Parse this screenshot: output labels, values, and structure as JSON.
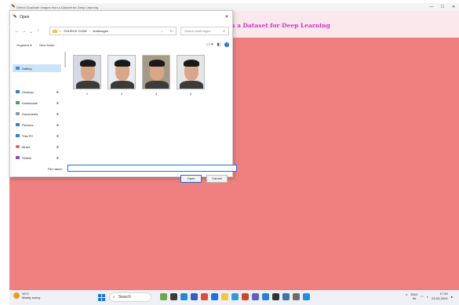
{
  "app": {
    "window_title": "Detect Duplicate Images from a Dataset for Deep Learning",
    "heading": "n a Dataset for Deep Learning",
    "controls": [
      "—",
      "☐",
      "✕"
    ],
    "colors": {
      "body": "#f08080",
      "header": "#fbe8ec",
      "heading": "#cc33cc"
    }
  },
  "dialog": {
    "title": "Open",
    "close": "✕",
    "breadcrumb": [
      "SOURCE CODE",
      "testImages"
    ],
    "breadcrumb_prefix": "«",
    "search_placeholder": "Search testImages",
    "organize_label": "Organize ▾",
    "new_folder_label": "New folder",
    "sidebar": {
      "items": [
        {
          "label": "Gallery",
          "icon": "gallery-icon",
          "color": "#3c8ee6"
        },
        {
          "label": "Desktop",
          "icon": "desktop-icon",
          "color": "#2f7fd6"
        },
        {
          "label": "Downloads",
          "icon": "download-icon",
          "color": "#2fae5a"
        },
        {
          "label": "Documents",
          "icon": "document-icon",
          "color": "#8a9bb0"
        },
        {
          "label": "Pictures",
          "icon": "pictures-icon",
          "color": "#2d88d8"
        },
        {
          "label": "This PC",
          "icon": "pc-icon",
          "color": "#2f7fd6"
        },
        {
          "label": "Music",
          "icon": "music-icon",
          "color": "#e8563a"
        },
        {
          "label": "Videos",
          "icon": "video-icon",
          "color": "#8b4cc9"
        }
      ]
    },
    "files": [
      {
        "name": "1",
        "bg": "#d6d9df"
      },
      {
        "name": "2",
        "bg": "#e9ecf0"
      },
      {
        "name": "3",
        "bg": "#a69a86"
      },
      {
        "name": "4",
        "bg": "#e6e6e6"
      }
    ],
    "filename_label": "File name:",
    "filename_value": "",
    "open_label": "Open",
    "cancel_label": "Cancel"
  },
  "taskbar": {
    "weather_temp": "19°C",
    "weather_desc": "Mostly sunny",
    "search_label": "Search",
    "lang_top": "ENG",
    "lang_bottom": "IN",
    "time": "17:29",
    "date": "23-03-2024",
    "apps": [
      {
        "icon": "widgets-icon",
        "color": "#6aa84f"
      },
      {
        "icon": "taskview-icon",
        "color": "#3c3c3c"
      },
      {
        "icon": "edge-icon",
        "color": "#1d8ad6"
      },
      {
        "icon": "store-icon",
        "color": "#2b62c4"
      },
      {
        "icon": "chrome-icon",
        "color": "#e24a3b"
      },
      {
        "icon": "mail-icon",
        "color": "#1a73e8"
      },
      {
        "icon": "explorer-icon",
        "color": "#f5c542"
      },
      {
        "icon": "photos-icon",
        "color": "#2f9bd8"
      },
      {
        "icon": "office-icon",
        "color": "#d04526"
      },
      {
        "icon": "teams-icon",
        "color": "#5b5fc7"
      },
      {
        "icon": "vscode-icon",
        "color": "#2a7fd4"
      },
      {
        "icon": "terminal-icon",
        "color": "#333333"
      },
      {
        "icon": "python-icon",
        "color": "#3b77a8"
      },
      {
        "icon": "settings-icon",
        "color": "#6b6b6b"
      },
      {
        "icon": "camera-icon",
        "color": "#1f8fe0"
      }
    ]
  }
}
